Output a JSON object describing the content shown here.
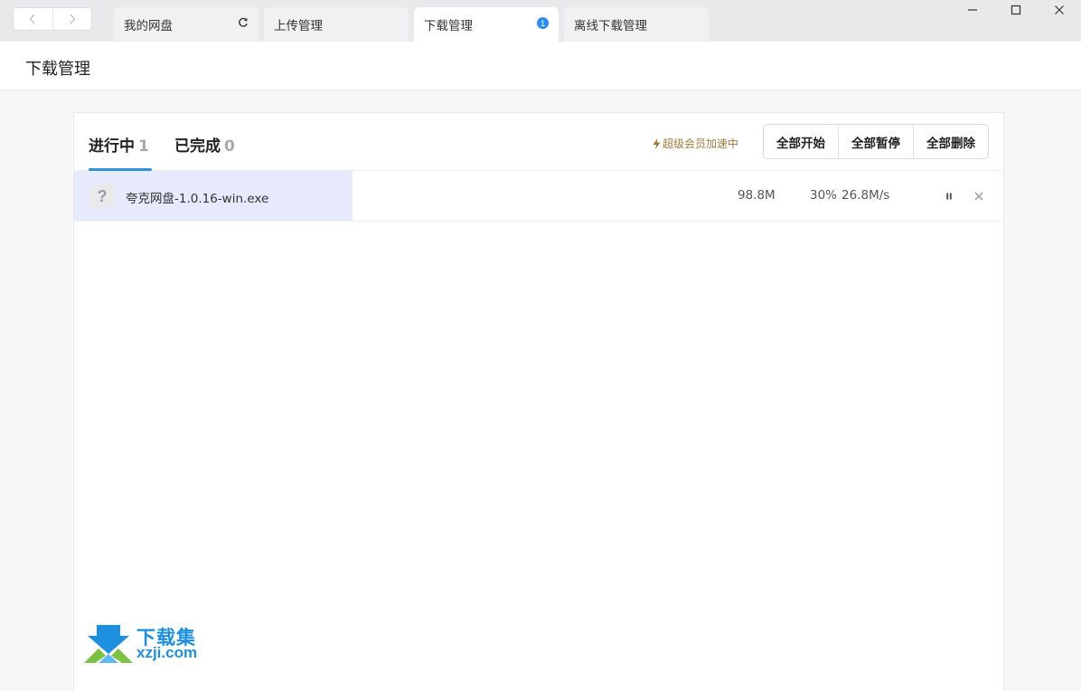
{
  "titlebar": {
    "back_icon": "chevron-left-icon",
    "forward_icon": "chevron-right-icon",
    "tabs": [
      {
        "label": "我的网盘",
        "extra_icon": "refresh-icon"
      },
      {
        "label": "上传管理"
      },
      {
        "label": "下载管理",
        "badge": "1",
        "active": true
      },
      {
        "label": "离线下载管理"
      }
    ],
    "window_controls": [
      "minimize-icon",
      "maximize-icon",
      "close-icon"
    ]
  },
  "header": {
    "title": "下载管理"
  },
  "panel": {
    "status_tabs": [
      {
        "label": "进行中",
        "count": "1",
        "active": true
      },
      {
        "label": "已完成",
        "count": "0"
      }
    ],
    "vip": {
      "label": "超级会员加速中",
      "icon": "lightning-icon",
      "color": "#a07a3c"
    },
    "actions": {
      "start_all": "全部开始",
      "pause_all": "全部暂停",
      "delete_all": "全部删除"
    },
    "tasks": [
      {
        "file_icon": "unknown-file-icon",
        "icon_glyph": "?",
        "name": "夸克网盘-1.0.16-win.exe",
        "size": "98.8M",
        "progress": "30%",
        "progress_fraction": 0.3,
        "speed": "26.8M/s",
        "pause_icon": "pause-icon",
        "remove_icon": "close-icon"
      }
    ]
  },
  "watermark": {
    "text_cn": "下载集",
    "text_en": "xzji.com"
  },
  "colors": {
    "accent": "#2b93d8",
    "badge": "#2d8cf0",
    "progress_fill": "#e7e9fd",
    "vip": "#a07a3c"
  }
}
